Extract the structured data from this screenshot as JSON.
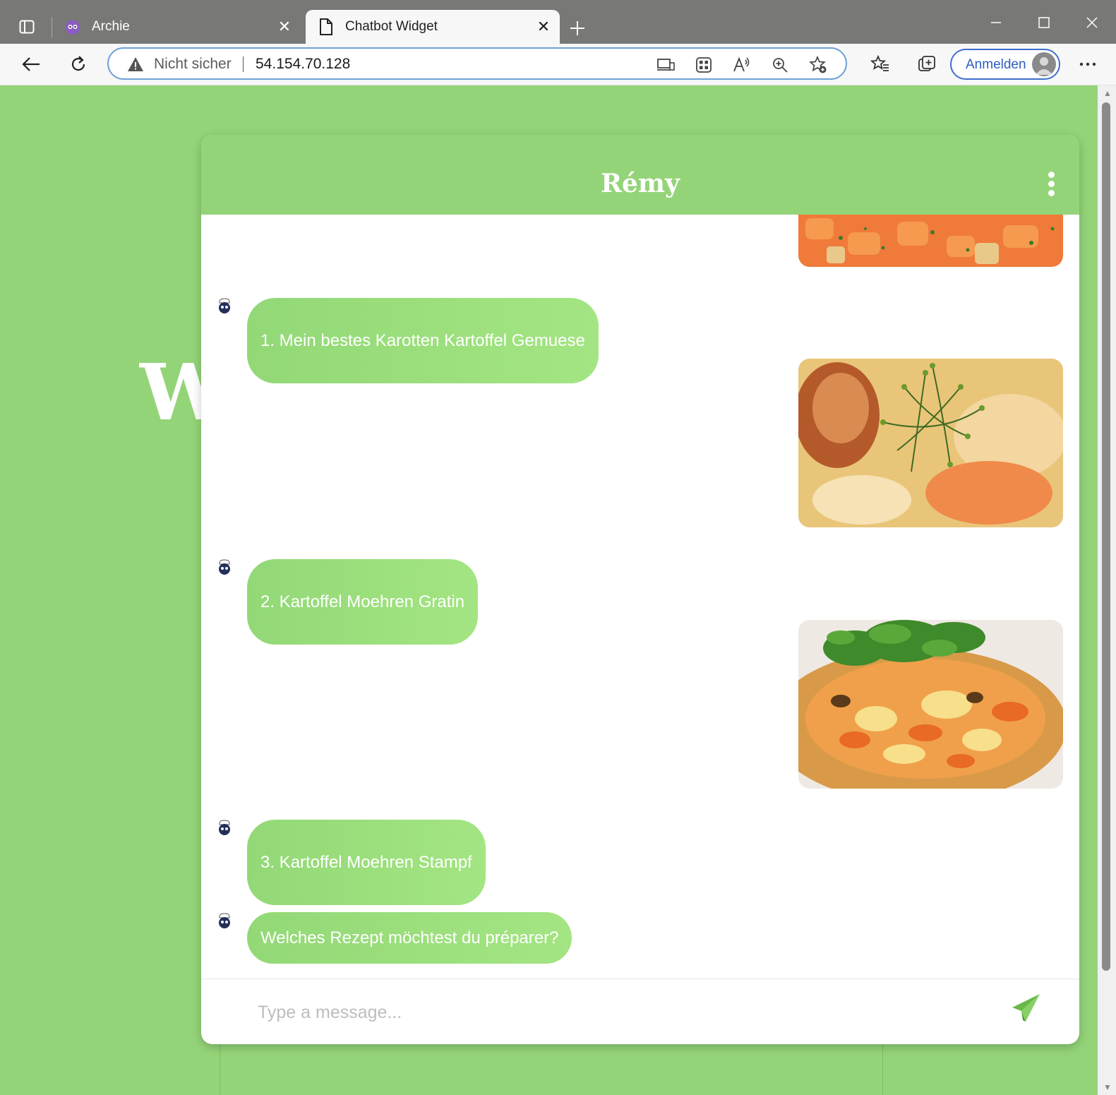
{
  "browser": {
    "tabs": [
      {
        "label": "Archie",
        "active": false
      },
      {
        "label": "Chatbot Widget",
        "active": true
      }
    ],
    "address": {
      "security": "Nicht sicher",
      "url": "54.154.70.128"
    },
    "signin_label": "Anmelden"
  },
  "page": {
    "background_letters": "W"
  },
  "chat": {
    "title": "Rémy",
    "messages": [
      {
        "type": "image",
        "alt": "Karotten Kartoffel Gemüse"
      },
      {
        "type": "bot_text",
        "text": "1. Mein bestes Karotten Kartoffel Gemuese"
      },
      {
        "type": "image",
        "alt": "Kartoffel Moehren Gratin"
      },
      {
        "type": "bot_text",
        "text": "2. Kartoffel Moehren Gratin"
      },
      {
        "type": "image",
        "alt": "Kartoffel Moehren Stampf"
      },
      {
        "type": "bot_text",
        "text": "3. Kartoffel Moehren Stampf"
      },
      {
        "type": "bot_text",
        "text": "Welches Rezept möchtest du préparer?"
      }
    ],
    "input_placeholder": "Type a message..."
  },
  "colors": {
    "brand_green": "#94d478",
    "bubble_green": "#9be07d",
    "tab_bar": "#787876"
  }
}
